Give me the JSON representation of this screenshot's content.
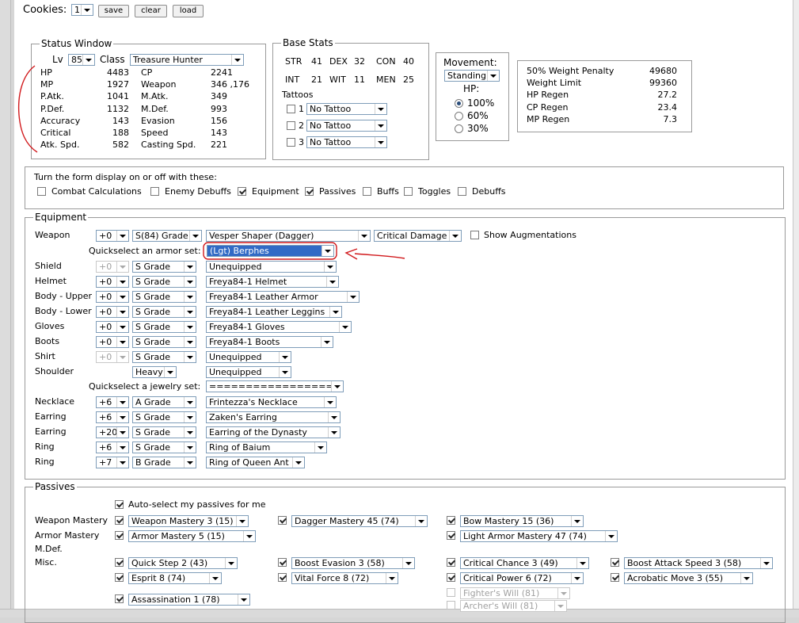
{
  "cookies": {
    "label": "Cookies:",
    "value": "1",
    "save": "save",
    "clear": "clear",
    "load": "load"
  },
  "status": {
    "title": "Status Window",
    "lv_label": "Lv",
    "lv_value": "85",
    "class_label": "Class",
    "class_value": "Treasure Hunter",
    "left": [
      [
        "HP",
        "4483"
      ],
      [
        "MP",
        "1927"
      ],
      [
        "P.Atk.",
        "1041"
      ],
      [
        "P.Def.",
        "1132"
      ],
      [
        "Accuracy",
        "143"
      ],
      [
        "Critical",
        "188"
      ],
      [
        "Atk. Spd.",
        "582"
      ]
    ],
    "right": [
      [
        "CP",
        "2241"
      ],
      [
        "Weapon",
        "346 ,176"
      ],
      [
        "M.Atk.",
        "349"
      ],
      [
        "M.Def.",
        "993"
      ],
      [
        "Evasion",
        "156"
      ],
      [
        "Speed",
        "143"
      ],
      [
        "Casting Spd.",
        "221"
      ]
    ]
  },
  "base": {
    "title": "Base Stats",
    "row1": [
      [
        "STR",
        "41"
      ],
      [
        "DEX",
        "32"
      ],
      [
        "CON",
        "40"
      ]
    ],
    "row2": [
      [
        "INT",
        "21"
      ],
      [
        "WIT",
        "11"
      ],
      [
        "MEN",
        "25"
      ]
    ],
    "tattoos_label": "Tattoos",
    "tattoos": [
      {
        "n": "1",
        "v": "No Tattoo"
      },
      {
        "n": "2",
        "v": "No Tattoo"
      },
      {
        "n": "3",
        "v": "No Tattoo"
      }
    ]
  },
  "movement": {
    "label": "Movement:",
    "value": "Standing",
    "hp_label": "HP:",
    "opts": [
      "100%",
      "60%",
      "30%"
    ]
  },
  "regen": [
    [
      "50% Weight Penalty",
      "49680"
    ],
    [
      "Weight Limit",
      "99360"
    ],
    [
      "HP Regen",
      "27.2"
    ],
    [
      "CP Regen",
      "23.4"
    ],
    [
      "MP Regen",
      "7.3"
    ]
  ],
  "toggles": {
    "caption": "Turn the form display on or off with these:",
    "items": [
      {
        "label": "Combat Calculations",
        "on": false
      },
      {
        "label": "Enemy Debuffs",
        "on": false
      },
      {
        "label": "Equipment",
        "on": true
      },
      {
        "label": "Passives",
        "on": true
      },
      {
        "label": "Buffs",
        "on": false
      },
      {
        "label": "Toggles",
        "on": false
      },
      {
        "label": "Debuffs",
        "on": false
      }
    ]
  },
  "equipment": {
    "title": "Equipment",
    "weapon_label": "Weapon",
    "weapon_enchant": "+0",
    "weapon_grade": "S(84) Grade",
    "weapon_item": "Vesper Shaper (Dagger)",
    "weapon_sa": "Critical Damage",
    "show_aug": "Show Augmentations",
    "armor_set_label": "Quickselect an armor set:",
    "armor_set_value": "(Lgt) Berphes",
    "armor": [
      {
        "label": "Shield",
        "enchant": "+0",
        "grade": "S Grade",
        "item": "Unequipped",
        "dis": true
      },
      {
        "label": "Helmet",
        "enchant": "+0",
        "grade": "S Grade",
        "item": "Freya84-1 Helmet"
      },
      {
        "label": "Body - Upper",
        "enchant": "+0",
        "grade": "S Grade",
        "item": "Freya84-1 Leather Armor"
      },
      {
        "label": "Body - Lower",
        "enchant": "+0",
        "grade": "S Grade",
        "item": "Freya84-1 Leather Leggins"
      },
      {
        "label": "Gloves",
        "enchant": "+0",
        "grade": "S Grade",
        "item": "Freya84-1 Gloves"
      },
      {
        "label": "Boots",
        "enchant": "+0",
        "grade": "S Grade",
        "item": "Freya84-1 Boots"
      },
      {
        "label": "Shirt",
        "enchant": "+0",
        "grade": "S Grade",
        "item": "Unequipped",
        "dis": true
      },
      {
        "label": "Shoulder",
        "grade": "Heavy",
        "item": "Unequipped"
      }
    ],
    "jewelry_set_label": "Quickselect a jewelry set:",
    "jewelry_set_value": "==================",
    "jewelry": [
      {
        "label": "Necklace",
        "enchant": "+6",
        "grade": "A Grade",
        "item": "Frintezza's Necklace"
      },
      {
        "label": "Earring",
        "enchant": "+6",
        "grade": "S Grade",
        "item": "Zaken's Earring"
      },
      {
        "label": "Earring",
        "enchant": "+20",
        "grade": "S Grade",
        "item": "Earring of the Dynasty"
      },
      {
        "label": "Ring",
        "enchant": "+6",
        "grade": "S Grade",
        "item": "Ring of Baium"
      },
      {
        "label": "Ring",
        "enchant": "+7",
        "grade": "B Grade",
        "item": "Ring of Queen Ant"
      }
    ]
  },
  "passives": {
    "title": "Passives",
    "auto": "Auto-select my passives for me",
    "row_labels": [
      "Weapon Mastery",
      "Armor Mastery",
      "M.Def.",
      "Misc."
    ],
    "items": {
      "weapon_mastery": "Weapon Mastery 3 (15)",
      "dagger_mastery": "Dagger Mastery 45 (74)",
      "bow_mastery": "Bow Mastery 15 (36)",
      "armor_mastery": "Armor Mastery 5 (15)",
      "light_armor_mastery": "Light Armor Mastery 47 (74)",
      "quick_step": "Quick Step 2 (43)",
      "boost_evasion": "Boost Evasion 3 (58)",
      "critical_chance": "Critical Chance 3 (49)",
      "boost_attack_speed": "Boost Attack Speed 3 (58)",
      "esprit": "Esprit 8 (74)",
      "vital_force": "Vital Force 8 (72)",
      "critical_power": "Critical Power 6 (72)",
      "acrobatic_move": "Acrobatic Move 3 (55)",
      "assassination": "Assassination 1 (78)",
      "fighters_will": "Fighter's Will (81)",
      "archers_will": "Archer's Will (81)"
    }
  },
  "colors": {
    "annotation": "#d1191c",
    "highlight": "#316ac5"
  }
}
